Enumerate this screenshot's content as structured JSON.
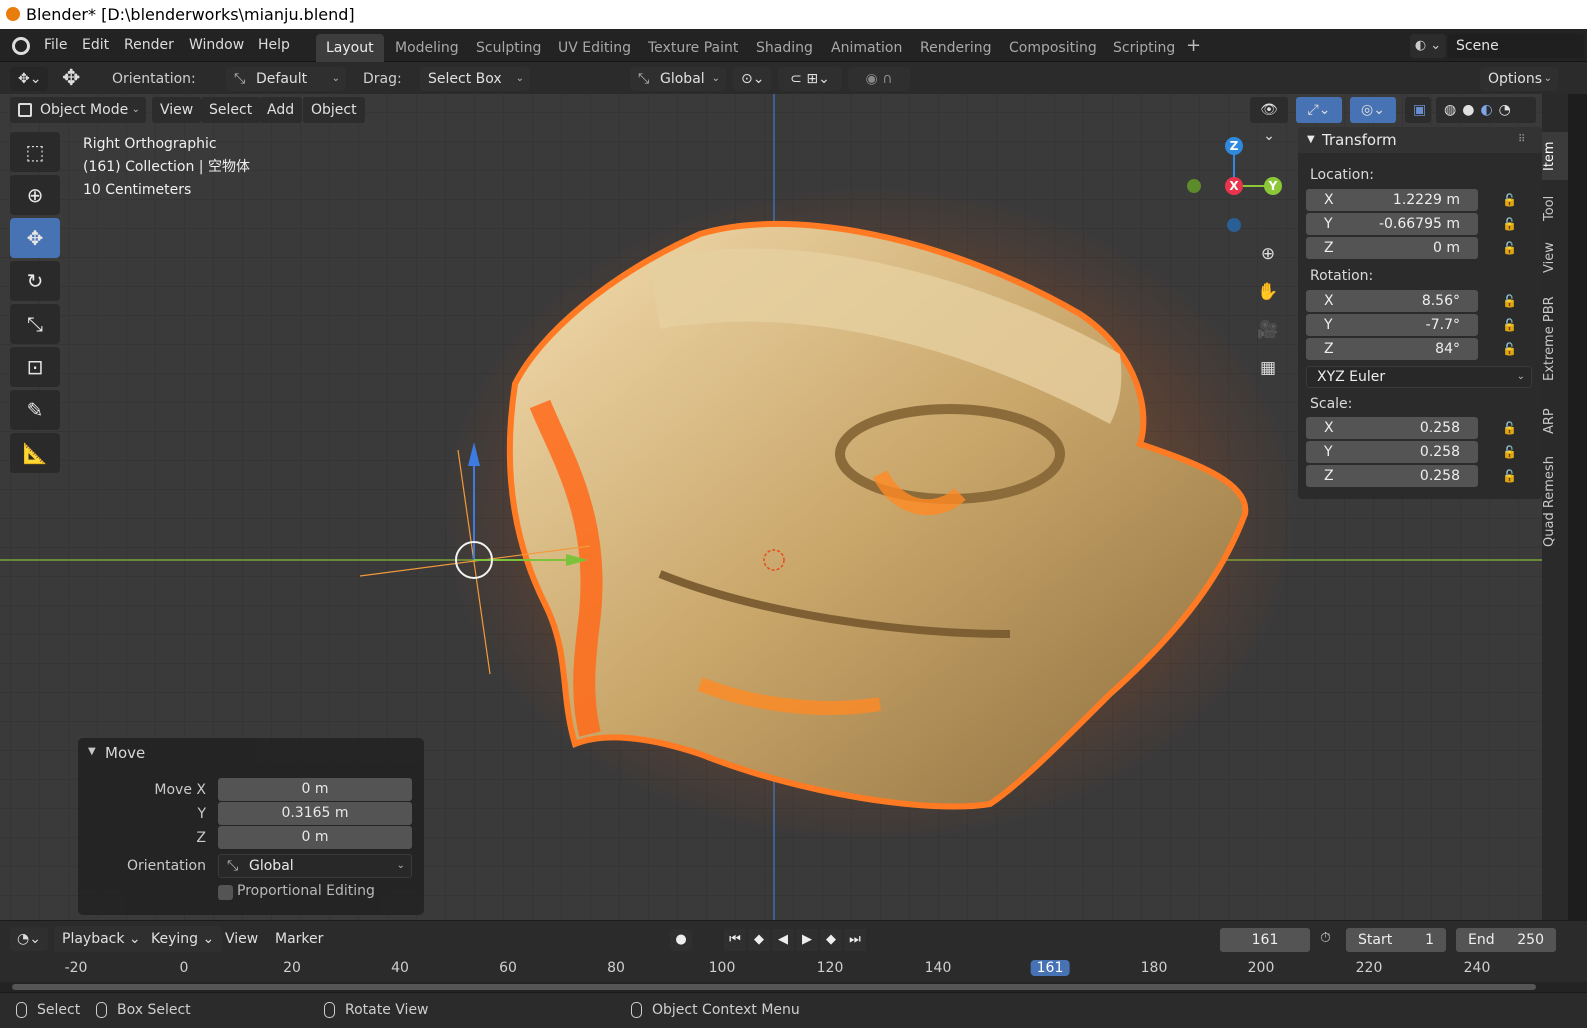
{
  "window": {
    "title": "Blender* [D:\\blenderworks\\mianju.blend]"
  },
  "menubar": {
    "items": [
      "File",
      "Edit",
      "Render",
      "Window",
      "Help"
    ]
  },
  "workspaces": [
    "Layout",
    "Modeling",
    "Sculpting",
    "UV Editing",
    "Texture Paint",
    "Shading",
    "Animation",
    "Rendering",
    "Compositing",
    "Scripting"
  ],
  "active_workspace": "Layout",
  "scene": {
    "name": "Scene"
  },
  "tool_header": {
    "orientation_label": "Orientation:",
    "orientation_value": "Default",
    "drag_label": "Drag:",
    "drag_value": "Select Box",
    "transform_orientation": "Global",
    "options_label": "Options"
  },
  "viewport_header": {
    "mode": "Object Mode",
    "menus": [
      "View",
      "Select",
      "Add",
      "Object"
    ]
  },
  "viewport_info": {
    "line1": "Right Orthographic",
    "line2": "(161) Collection | 空物体",
    "line3": "10 Centimeters"
  },
  "gizmo": {
    "z": "Z",
    "x": "X",
    "y": "Y"
  },
  "n_panel": {
    "title": "Transform",
    "location_label": "Location:",
    "location": [
      {
        "axis": "X",
        "value": "1.2229 m"
      },
      {
        "axis": "Y",
        "value": "-0.66795 m"
      },
      {
        "axis": "Z",
        "value": "0 m"
      }
    ],
    "rotation_label": "Rotation:",
    "rotation": [
      {
        "axis": "X",
        "value": "8.56°"
      },
      {
        "axis": "Y",
        "value": "-7.7°"
      },
      {
        "axis": "Z",
        "value": "84°"
      }
    ],
    "rotation_mode": "XYZ Euler",
    "scale_label": "Scale:",
    "scale": [
      {
        "axis": "X",
        "value": "0.258"
      },
      {
        "axis": "Y",
        "value": "0.258"
      },
      {
        "axis": "Z",
        "value": "0.258"
      }
    ]
  },
  "side_tabs": [
    "Item",
    "Tool",
    "View",
    "Extreme PBR",
    "ARP",
    "Quad Remesh"
  ],
  "operator_panel": {
    "title": "Move",
    "move_x_label": "Move X",
    "move_x": "0 m",
    "y_label": "Y",
    "y": "0.3165 m",
    "z_label": "Z",
    "z": "0 m",
    "orientation_label": "Orientation",
    "orientation_value": "Global",
    "proportional_label": "Proportional Editing"
  },
  "timeline": {
    "menus": [
      "Playback",
      "Keying",
      "View",
      "Marker"
    ],
    "current_frame": "161",
    "start_label": "Start",
    "start": "1",
    "end_label": "End",
    "end": "250",
    "ruler": [
      "-20",
      "0",
      "20",
      "40",
      "60",
      "80",
      "100",
      "120",
      "140",
      "161",
      "180",
      "200",
      "220",
      "240"
    ]
  },
  "statusbar": {
    "select": "Select",
    "box_select": "Box Select",
    "rotate_view": "Rotate View",
    "context_menu": "Object Context Menu"
  },
  "colors": {
    "accent": "#4772b3",
    "x_axis": "#e8344d",
    "y_axis": "#8bc736",
    "z_axis": "#2f89dd"
  }
}
